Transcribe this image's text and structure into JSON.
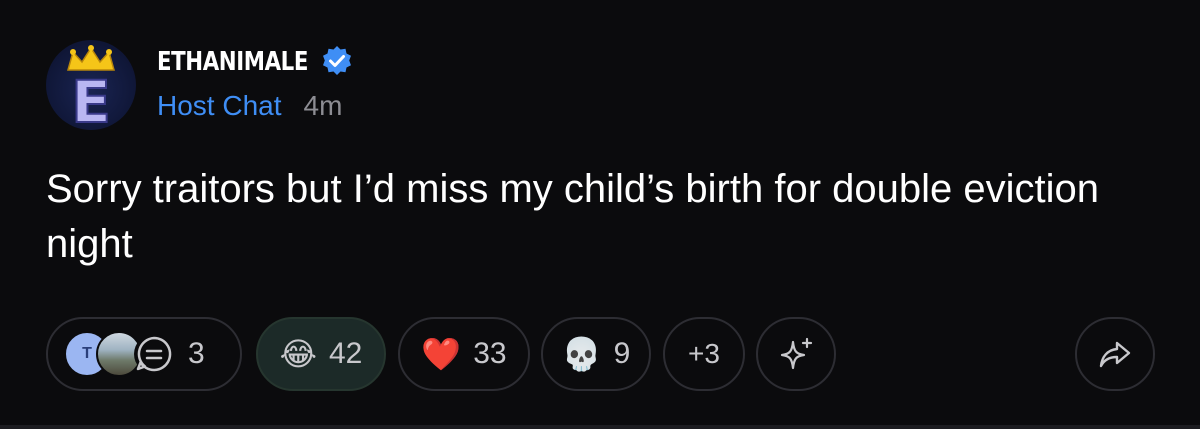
{
  "post": {
    "username": "ETHANIMALE",
    "verified": true,
    "channel": "Host Chat",
    "time": "4m",
    "text": "Sorry traitors but I’d miss my child’s birth for double eviction night",
    "avatar_letter": "E",
    "reply_avatar_initial": "T"
  },
  "reactions": {
    "replies_count": "3",
    "laugh": {
      "emoji": "😂",
      "count": "42"
    },
    "heart": {
      "emoji": "❤️",
      "count": "33"
    },
    "skull": {
      "emoji": "💀",
      "count": "9"
    },
    "more_label": "+3"
  },
  "icons": {
    "verified": "verified-badge-icon",
    "replies": "chat-bubble-icon",
    "add_reaction": "sparkle-add-reaction-icon",
    "share": "share-arrow-icon"
  },
  "colors": {
    "background": "#0b0b0d",
    "channel": "#3f8ef5",
    "verified": "#3f8ef5",
    "active_pill": "#1c2a28"
  }
}
